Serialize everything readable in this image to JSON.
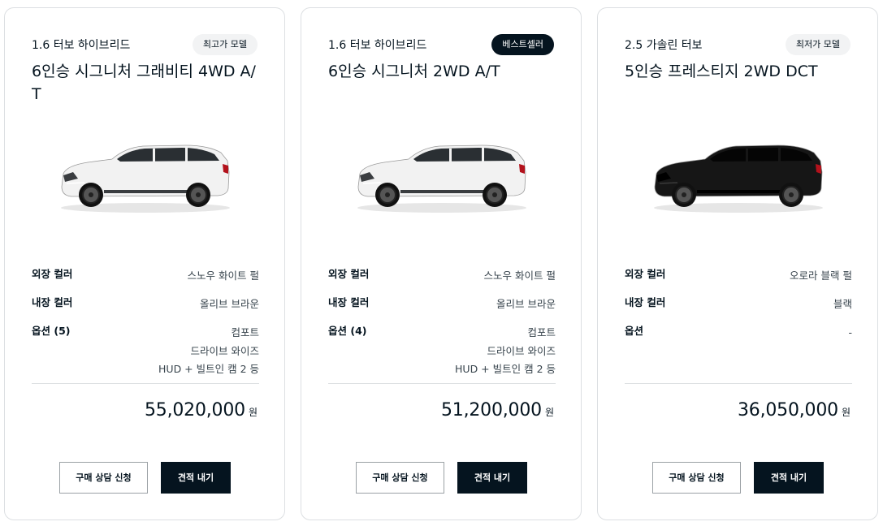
{
  "labels": {
    "exterior": "외장 컬러",
    "interior": "내장 컬러",
    "currency": "원",
    "consult_button": "구매 상담 신청",
    "quote_button": "견적 내기"
  },
  "cards": [
    {
      "engine": "1.6 터보 하이브리드",
      "badge": "최고가 모델",
      "badge_style": "light",
      "model": "6인승 시그니처 그래비티 4WD A/T",
      "car_color": "#f2f2f2",
      "exterior_color": "스노우 화이트 펄",
      "interior_color": "올리브 브라운",
      "options_label": "옵션 (5)",
      "options": [
        "컴포트",
        "드라이브 와이즈",
        "HUD + 빌트인 캠 2 등"
      ],
      "price": "55,020,000"
    },
    {
      "engine": "1.6 터보 하이브리드",
      "badge": "베스트셀러",
      "badge_style": "dark",
      "model": "6인승 시그니처 2WD A/T",
      "car_color": "#f2f2f2",
      "exterior_color": "스노우 화이트 펄",
      "interior_color": "올리브 브라운",
      "options_label": "옵션 (4)",
      "options": [
        "컴포트",
        "드라이브 와이즈",
        "HUD + 빌트인 캠 2 등"
      ],
      "price": "51,200,000"
    },
    {
      "engine": "2.5 가솔린 터보",
      "badge": "최저가 모델",
      "badge_style": "light",
      "model": "5인승 프레스티지 2WD DCT",
      "car_color": "#161616",
      "exterior_color": "오로라 블랙 펄",
      "interior_color": "블랙",
      "options_label": "옵션",
      "options": [
        "-"
      ],
      "price": "36,050,000"
    }
  ]
}
